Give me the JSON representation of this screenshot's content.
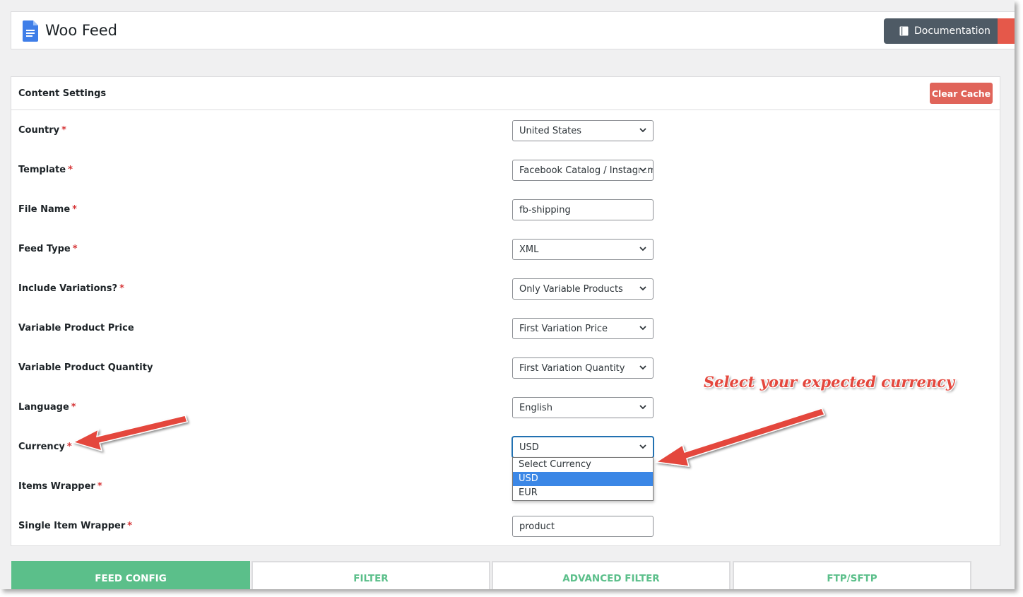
{
  "app": {
    "title": "Woo Feed",
    "documentation_label": "Documentation"
  },
  "panel": {
    "title": "Content Settings",
    "clear_cache_label": "Clear Cache",
    "fields": {
      "country": {
        "label": "Country",
        "value": "United States"
      },
      "template": {
        "label": "Template",
        "value": "Facebook Catalog / Instagram"
      },
      "file_name": {
        "label": "File Name",
        "value": "fb-shipping"
      },
      "feed_type": {
        "label": "Feed Type",
        "value": "XML"
      },
      "include_variations": {
        "label": "Include Variations?",
        "value": "Only Variable Products"
      },
      "variable_price": {
        "label": "Variable Product Price",
        "value": "First Variation Price"
      },
      "variable_quantity": {
        "label": "Variable Product Quantity",
        "value": "First Variation Quantity"
      },
      "language": {
        "label": "Language",
        "value": "English"
      },
      "currency": {
        "label": "Currency",
        "value": "USD",
        "options": [
          "Select Currency",
          "USD",
          "EUR"
        ]
      },
      "items_wrapper": {
        "label": "Items Wrapper"
      },
      "single_item_wrapper": {
        "label": "Single Item Wrapper",
        "value": "product"
      }
    },
    "required_mark": "*"
  },
  "callout": {
    "text": "Select your expected currency",
    "color": "#e4473d"
  },
  "tabs": [
    "FEED CONFIG",
    "FILTER",
    "ADVANCED FILTER",
    "FTP/SFTP"
  ],
  "colors": {
    "accent_green": "#5bbf8a",
    "clear_cache_red": "#e0645a",
    "doc_button": "#4e5a65",
    "selected_option": "#3b87e6"
  },
  "icons": {
    "logo": "document-icon",
    "documentation": "book-icon",
    "select_arrow": "chevron-down-icon",
    "annotation": "arrow-icon"
  }
}
